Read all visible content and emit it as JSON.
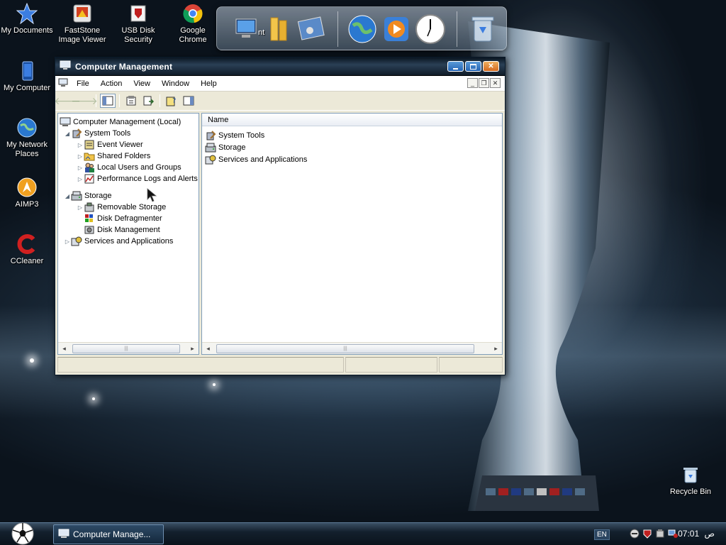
{
  "desktop": {
    "icons": [
      {
        "label": "My Documents",
        "icon": "star-icon"
      },
      {
        "label": "FastStone Image Viewer",
        "icon": "faststone-icon"
      },
      {
        "label": "USB Disk Security",
        "icon": "usb-security-icon"
      },
      {
        "label": "Google Chrome",
        "icon": "chrome-icon"
      },
      {
        "label": "My Computer",
        "icon": "computer-icon"
      },
      {
        "label": "My Network Places",
        "icon": "network-globe-icon"
      },
      {
        "label": "AIMP3",
        "icon": "aimp-icon"
      },
      {
        "label": "CCleaner",
        "icon": "ccleaner-icon"
      },
      {
        "label": "Recycle Bin",
        "icon": "recycle-bin-icon"
      }
    ],
    "dock_partial_label": "nt"
  },
  "window": {
    "title": "Computer Management",
    "menu": [
      "File",
      "Action",
      "View",
      "Window",
      "Help"
    ],
    "tree": {
      "root": "Computer Management (Local)",
      "items": [
        {
          "label": "System Tools",
          "level": 1,
          "expanded": true
        },
        {
          "label": "Event Viewer",
          "level": 2,
          "expanded": false
        },
        {
          "label": "Shared Folders",
          "level": 2,
          "expanded": false
        },
        {
          "label": "Local Users and Groups",
          "level": 2,
          "expanded": false
        },
        {
          "label": "Performance Logs and Alerts",
          "level": 2,
          "expanded": false
        },
        {
          "label": "Storage",
          "level": 1,
          "expanded": true
        },
        {
          "label": "Removable Storage",
          "level": 2,
          "expanded": false
        },
        {
          "label": "Disk Defragmenter",
          "level": 2,
          "expanded": null
        },
        {
          "label": "Disk Management",
          "level": 2,
          "expanded": null
        },
        {
          "label": "Services and Applications",
          "level": 1,
          "expanded": false
        }
      ]
    },
    "list": {
      "column": "Name",
      "items": [
        "System Tools",
        "Storage",
        "Services and Applications"
      ]
    }
  },
  "taskbar": {
    "task_label": "Computer Manage...",
    "language": "EN",
    "clock": "07:01",
    "ampm": "ص"
  }
}
